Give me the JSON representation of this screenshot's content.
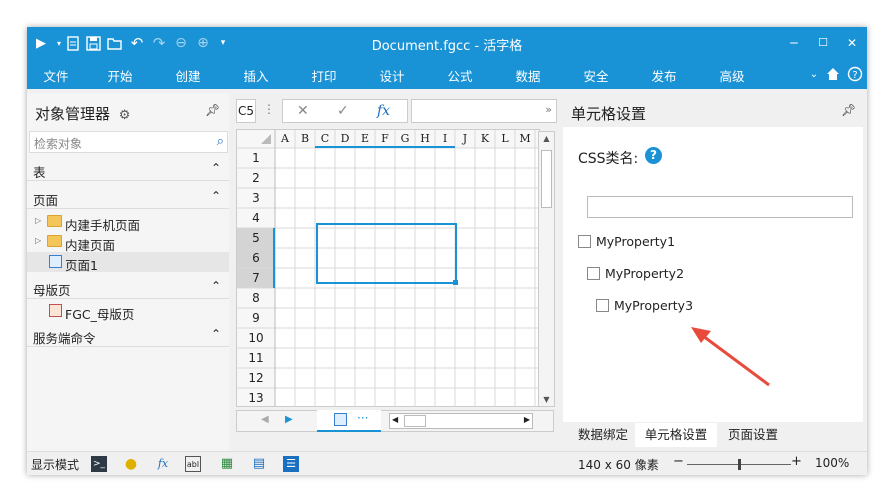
{
  "titlebar": {
    "title": "Document.fgcc - 活字格",
    "buttons": [
      "play-icon",
      "dropdown-icon",
      "new-icon",
      "save-icon",
      "open-icon",
      "undo-icon",
      "redo-icon",
      "back-icon",
      "forward-icon",
      "customize-icon"
    ],
    "min": "‒",
    "max": "☐",
    "close": "✕"
  },
  "menu": {
    "items": [
      "文件",
      "开始",
      "创建",
      "插入",
      "打印",
      "设计",
      "公式",
      "数据",
      "安全",
      "发布",
      "高级"
    ]
  },
  "left_panel": {
    "title": "对象管理器",
    "search_placeholder": "检索对象",
    "sections": {
      "tables": "表",
      "pages": "页面",
      "master": "母版页",
      "server": "服务端命令"
    },
    "pages": [
      "内建手机页面",
      "内建页面",
      "页面1"
    ],
    "master_pages": [
      "FGC_母版页"
    ]
  },
  "editor": {
    "cell_ref": "C5",
    "columns": [
      "A",
      "B",
      "C",
      "D",
      "E",
      "F",
      "G",
      "H",
      "I",
      "J",
      "K",
      "L",
      "M"
    ],
    "rows": [
      "1",
      "2",
      "3",
      "4",
      "5",
      "6",
      "7",
      "8",
      "9",
      "10",
      "11",
      "12",
      "13"
    ],
    "more": "···"
  },
  "right_panel": {
    "title": "单元格设置",
    "css_label": "CSS类名:",
    "css_value": "",
    "properties": [
      "MyProperty1",
      "MyProperty2",
      "MyProperty3"
    ],
    "tabs": [
      "数据绑定",
      "单元格设置",
      "页面设置"
    ],
    "active_tab": "单元格设置"
  },
  "statusbar": {
    "mode_label": "显示模式",
    "dimensions": "140 x 60 像素",
    "zoom": "100%",
    "zoom_level": 0.5,
    "minus": "−",
    "plus": "+"
  },
  "colors": {
    "accent": "#1a93d6",
    "arrow": "#e84a3b",
    "selection": "#1a93d6"
  }
}
